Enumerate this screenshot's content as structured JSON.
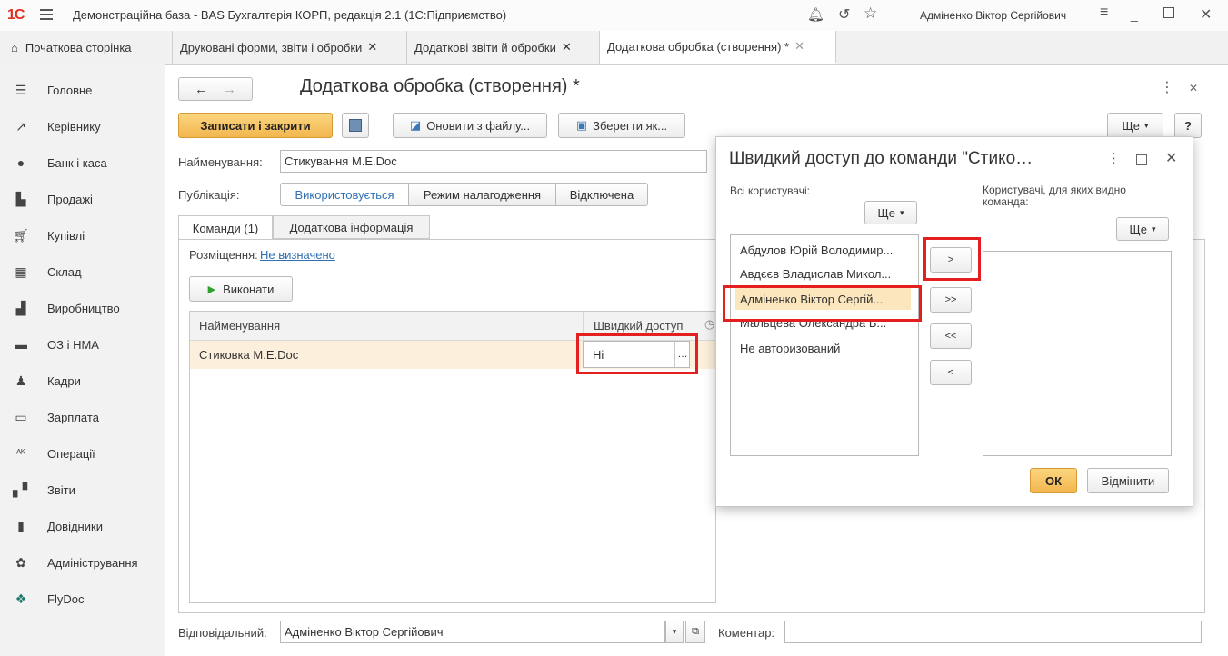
{
  "titlebar": {
    "logo": "1С",
    "title": "Демонстраційна база - BAS Бухгалтерія КОРП, редакція 2.1  (1С:Підприємство)",
    "user": "Адміненко Віктор Сергійович"
  },
  "tabs": [
    {
      "label": "Початкова сторінка"
    },
    {
      "label": "Друковані форми, звіти і обробки"
    },
    {
      "label": "Додаткові звіти й обробки"
    },
    {
      "label": "Додаткова обробка (створення) *"
    }
  ],
  "sidebar": {
    "items": [
      {
        "label": "Головне",
        "icon": "menu-icon"
      },
      {
        "label": "Керівнику",
        "icon": "chart-icon"
      },
      {
        "label": "Банк і каса",
        "icon": "bank-icon"
      },
      {
        "label": "Продажі",
        "icon": "sales-icon"
      },
      {
        "label": "Купівлі",
        "icon": "cart-icon"
      },
      {
        "label": "Склад",
        "icon": "warehouse-icon"
      },
      {
        "label": "Виробництво",
        "icon": "factory-icon"
      },
      {
        "label": "ОЗ і НМА",
        "icon": "truck-icon"
      },
      {
        "label": "Кадри",
        "icon": "person-icon"
      },
      {
        "label": "Зарплата",
        "icon": "wallet-icon"
      },
      {
        "label": "Операції",
        "icon": "operations-icon"
      },
      {
        "label": "Звіти",
        "icon": "reports-icon"
      },
      {
        "label": "Довідники",
        "icon": "book-icon"
      },
      {
        "label": "Адміністрування",
        "icon": "gear-icon"
      },
      {
        "label": "FlyDoc",
        "icon": "flydoc-icon"
      }
    ]
  },
  "form": {
    "title": "Додаткова обробка (створення) *",
    "save_close": "Записати і закрити",
    "update_from_file": "Оновити з файлу...",
    "save_as": "Зберегти як...",
    "more": "Ще",
    "help": "?",
    "name_label": "Найменування:",
    "name_value": "Стикування M.E.Doc",
    "publication_label": "Публікація:",
    "publication_options": [
      "Використовується",
      "Режим налагодження",
      "Відключена"
    ],
    "subtabs": [
      "Команди (1)",
      "Додаткова інформація"
    ],
    "placement_label": "Розміщення:",
    "placement_value": "Не визначено",
    "run": "Виконати",
    "grid": {
      "columns": [
        "Найменування",
        "Швидкий доступ"
      ],
      "rows": [
        {
          "name": "Стиковка M.E.Doc",
          "quick": "Ні"
        }
      ]
    },
    "responsible_label": "Відповідальний:",
    "responsible_value": "Адміненко Віктор Сергійович",
    "comment_label": "Коментар:",
    "comment_value": ""
  },
  "dialog": {
    "title": "Швидкий доступ до команди \"Стико…",
    "all_users_label": "Всі користувачі:",
    "visible_users_label": "Користувачі, для яких видно команда:",
    "more": "Ще",
    "all_users": [
      "Абдулов Юрій Володимир...",
      "Авдєєв Владислав Микол...",
      "Адміненко Віктор Сергій...",
      "Мальцева Олександра Б...",
      "Не авторизований"
    ],
    "selected_index": 2,
    "move_buttons": [
      ">",
      ">>",
      "<<",
      "<"
    ],
    "ok": "ОК",
    "cancel": "Відмінити"
  }
}
